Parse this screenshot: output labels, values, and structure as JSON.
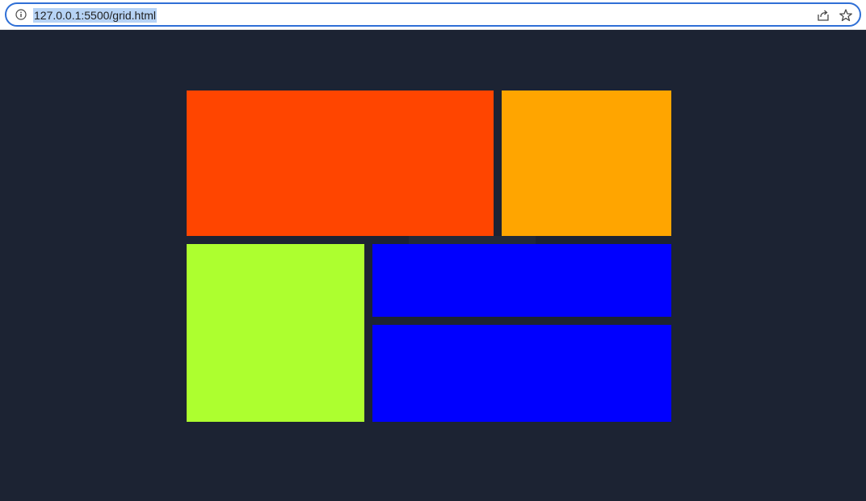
{
  "browser": {
    "url": "127.0.0.1:5500/grid.html",
    "icons": {
      "site_info": "info-icon",
      "share": "share-icon",
      "bookmark": "star-icon"
    }
  },
  "page": {
    "background": "#1c2333",
    "tiles": [
      {
        "name": "tile-orange-red",
        "color": "#ff4500"
      },
      {
        "name": "tile-orange",
        "color": "#ffa500"
      },
      {
        "name": "tile-green-yellow",
        "color": "#adff2f"
      },
      {
        "name": "tile-blue-top",
        "color": "#0000ff"
      },
      {
        "name": "tile-blue-bottom",
        "color": "#0000ff"
      }
    ]
  }
}
